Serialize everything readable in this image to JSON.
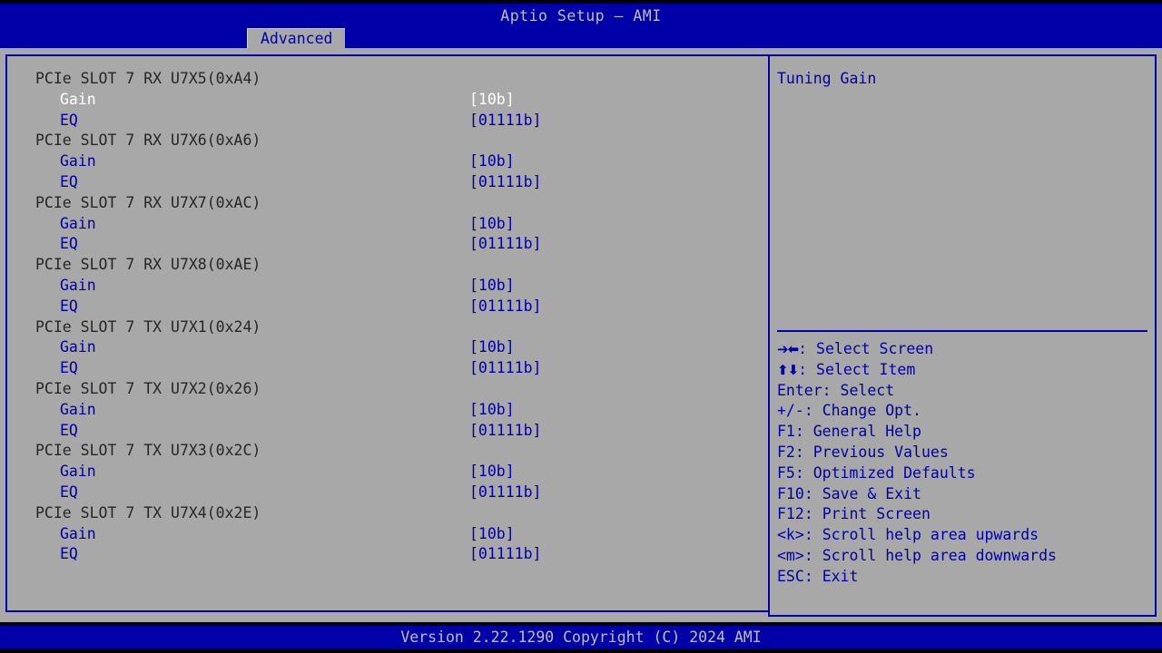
{
  "window": {
    "title": "Aptio Setup – AMI"
  },
  "tabs": [
    {
      "label": "Advanced",
      "active": true
    }
  ],
  "options": {
    "rows": [
      {
        "type": "group",
        "label": "PCIe SLOT 7 RX U7X5(0xA4)",
        "value": "",
        "selected": false
      },
      {
        "type": "child",
        "label": "Gain",
        "value": "[10b]",
        "selected": true
      },
      {
        "type": "child",
        "label": "EQ",
        "value": "[01111b]",
        "selected": false
      },
      {
        "type": "group",
        "label": "PCIe SLOT 7 RX U7X6(0xA6)",
        "value": "",
        "selected": false
      },
      {
        "type": "child",
        "label": "Gain",
        "value": "[10b]",
        "selected": false
      },
      {
        "type": "child",
        "label": "EQ",
        "value": "[01111b]",
        "selected": false
      },
      {
        "type": "group",
        "label": "PCIe SLOT 7 RX U7X7(0xAC)",
        "value": "",
        "selected": false
      },
      {
        "type": "child",
        "label": "Gain",
        "value": "[10b]",
        "selected": false
      },
      {
        "type": "child",
        "label": "EQ",
        "value": "[01111b]",
        "selected": false
      },
      {
        "type": "group",
        "label": "PCIe SLOT 7 RX U7X8(0xAE)",
        "value": "",
        "selected": false
      },
      {
        "type": "child",
        "label": "Gain",
        "value": "[10b]",
        "selected": false
      },
      {
        "type": "child",
        "label": "EQ",
        "value": "[01111b]",
        "selected": false
      },
      {
        "type": "group",
        "label": "PCIe SLOT 7 TX U7X1(0x24)",
        "value": "",
        "selected": false
      },
      {
        "type": "child",
        "label": "Gain",
        "value": "[10b]",
        "selected": false
      },
      {
        "type": "child",
        "label": "EQ",
        "value": "[01111b]",
        "selected": false
      },
      {
        "type": "group",
        "label": "PCIe SLOT 7 TX U7X2(0x26)",
        "value": "",
        "selected": false
      },
      {
        "type": "child",
        "label": "Gain",
        "value": "[10b]",
        "selected": false
      },
      {
        "type": "child",
        "label": "EQ",
        "value": "[01111b]",
        "selected": false
      },
      {
        "type": "group",
        "label": "PCIe SLOT 7 TX U7X3(0x2C)",
        "value": "",
        "selected": false
      },
      {
        "type": "child",
        "label": "Gain",
        "value": "[10b]",
        "selected": false
      },
      {
        "type": "child",
        "label": "EQ",
        "value": "[01111b]",
        "selected": false
      },
      {
        "type": "group",
        "label": "PCIe SLOT 7 TX U7X4(0x2E)",
        "value": "",
        "selected": false
      },
      {
        "type": "child",
        "label": "Gain",
        "value": "[10b]",
        "selected": false
      },
      {
        "type": "child",
        "label": "EQ",
        "value": "[01111b]",
        "selected": false
      }
    ]
  },
  "help": {
    "description": "Tuning Gain",
    "keys": [
      {
        "glyph": "➔⬅",
        "icon": "arrow-left-right-icon",
        "key": "",
        "sep": ": ",
        "action": "Select Screen"
      },
      {
        "glyph": "⬆⬇",
        "icon": "arrow-up-down-icon",
        "key": "",
        "sep": ": ",
        "action": "Select Item"
      },
      {
        "glyph": "",
        "icon": "",
        "key": "Enter",
        "sep": ": ",
        "action": "Select"
      },
      {
        "glyph": "",
        "icon": "",
        "key": "+/-",
        "sep": ": ",
        "action": "Change Opt."
      },
      {
        "glyph": "",
        "icon": "",
        "key": "F1",
        "sep": ": ",
        "action": "General Help"
      },
      {
        "glyph": "",
        "icon": "",
        "key": "F2",
        "sep": ": ",
        "action": "Previous Values"
      },
      {
        "glyph": "",
        "icon": "",
        "key": "F5",
        "sep": ": ",
        "action": "Optimized Defaults"
      },
      {
        "glyph": "",
        "icon": "",
        "key": "F10",
        "sep": ": ",
        "action": "Save & Exit"
      },
      {
        "glyph": "",
        "icon": "",
        "key": "F12",
        "sep": ": ",
        "action": "Print Screen"
      },
      {
        "glyph": "",
        "icon": "",
        "key": "<k>",
        "sep": ": ",
        "action": "Scroll help area upwards"
      },
      {
        "glyph": "",
        "icon": "",
        "key": "<m>",
        "sep": ": ",
        "action": "Scroll help area downwards"
      },
      {
        "glyph": "",
        "icon": "",
        "key": "ESC",
        "sep": ": ",
        "action": "Exit"
      }
    ]
  },
  "footer": {
    "version": "Version 2.22.1290 Copyright (C) 2024 AMI"
  },
  "colors": {
    "bios_blue": "#0000a8",
    "panel_gray": "#a8a8a8",
    "selected_text": "#ffffff",
    "item_text": "#0000a8",
    "group_text": "#262626",
    "titlebar_text": "#bfbfbf"
  }
}
